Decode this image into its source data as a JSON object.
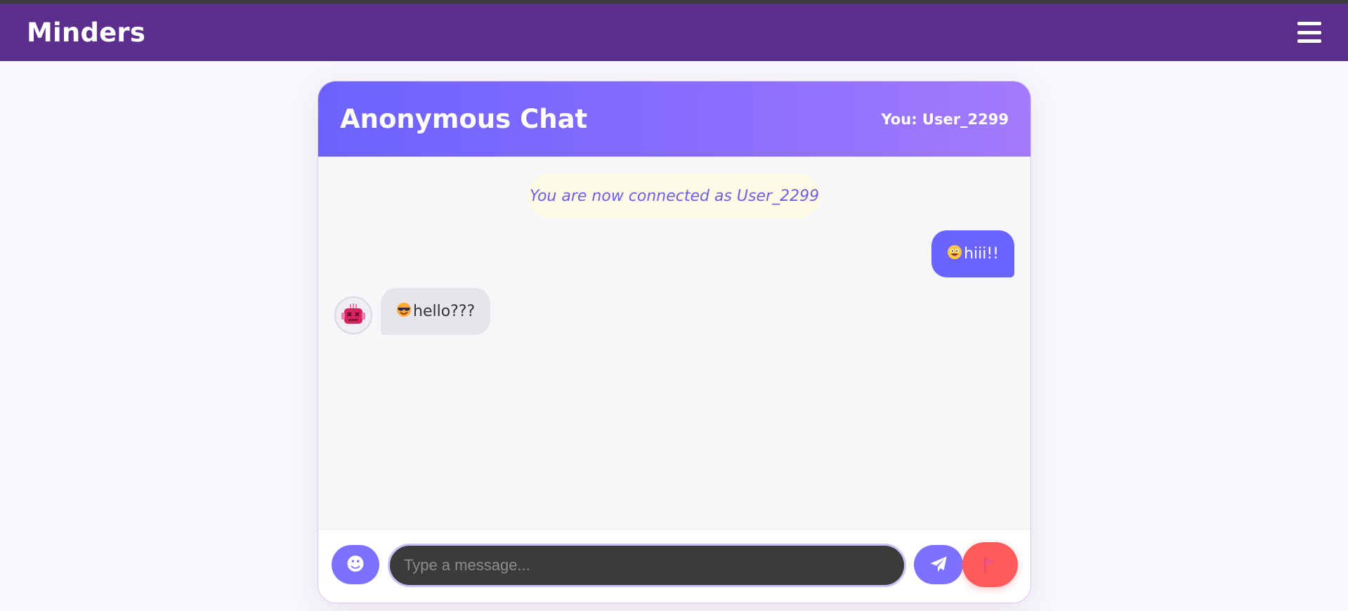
{
  "app": {
    "brand": "Minders"
  },
  "navbar": {
    "menu_icon": "hamburger-menu-icon"
  },
  "chat": {
    "title": "Anonymous Chat",
    "current_user": "You: User_2299",
    "system_message": "You are now connected as User_2299",
    "messages": [
      {
        "direction": "sent",
        "emoji": "grinning-face-emoji",
        "text": "hiii!!"
      },
      {
        "direction": "received",
        "emoji": "smiling-face-with-sunglasses-emoji",
        "text": "hello???"
      }
    ],
    "partner_avatar": "pink-robot-avatar"
  },
  "composer": {
    "placeholder": "Type a message...",
    "value": "",
    "emoji_button_icon": "smiley-icon",
    "send_button_icon": "paper-plane-icon",
    "report_button_icon": "flag-icon"
  },
  "colors": {
    "navbar": "#5c2e8e",
    "accent": "#6b63ff",
    "report": "#ff5b5b"
  }
}
